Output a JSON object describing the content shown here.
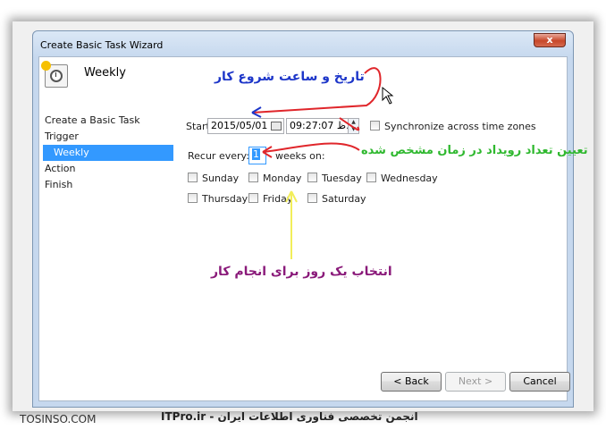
{
  "window": {
    "title": "Create Basic Task Wizard",
    "close_glyph": "x"
  },
  "header": {
    "title": "Weekly",
    "icon": "task-scheduler-icon"
  },
  "sidebar": {
    "items": [
      {
        "label": "Create a Basic Task"
      },
      {
        "label": "Trigger"
      },
      {
        "label": "Weekly"
      },
      {
        "label": "Action"
      },
      {
        "label": "Finish"
      }
    ],
    "active": "Weekly"
  },
  "start": {
    "label": "Start:",
    "date": "2015/05/01",
    "time": "09:27:07 ب.ظ",
    "sync_label": "Synchronize across time zones"
  },
  "recur": {
    "label": "Recur every:",
    "value": "1",
    "suffix": "weeks on:"
  },
  "days": [
    {
      "label": "Sunday"
    },
    {
      "label": "Monday"
    },
    {
      "label": "Tuesday"
    },
    {
      "label": "Wednesday"
    },
    {
      "label": "Thursday"
    },
    {
      "label": "Friday"
    },
    {
      "label": "Saturday"
    }
  ],
  "buttons": {
    "back": "< Back",
    "next": "Next >",
    "cancel": "Cancel"
  },
  "annotations": {
    "start_note": "تاریخ و ساعت شروع کار",
    "recur_note": "تعیین تعداد رویداد در زمان مشخص شده",
    "day_note": "انتخاب یک روز برای انجام کار"
  },
  "watermark": {
    "left": "TOSINSO.COM",
    "right": "ITPro.ir - انجمن تخصصی فناوری اطلاعات ایران"
  },
  "colors": {
    "annot_blue": "#1d36c9",
    "annot_green": "#2fb82f",
    "annot_purple": "#8a1a7a",
    "arrow_red": "#e0262b",
    "arrow_yellow": "#f2ee5a",
    "selection": "#3399ff"
  }
}
